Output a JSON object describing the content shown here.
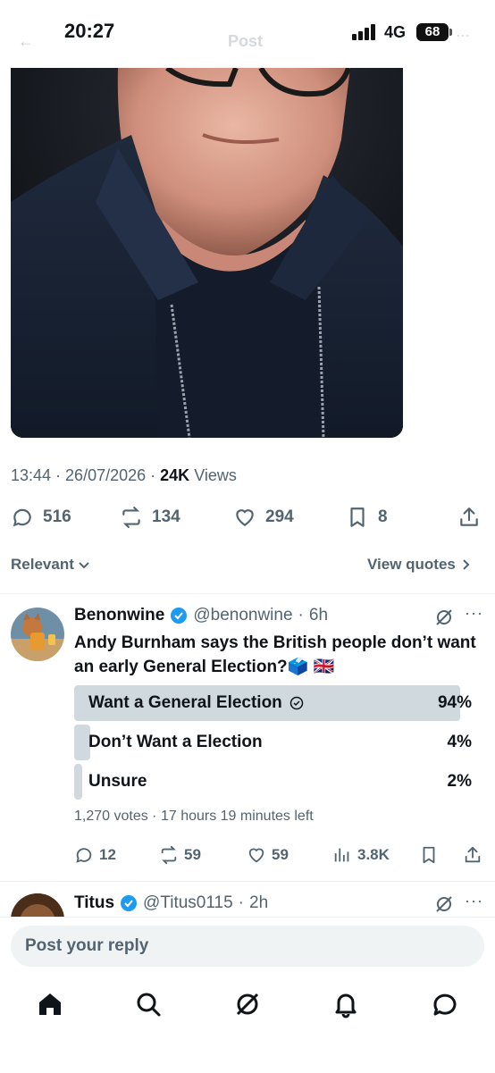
{
  "status_bar": {
    "time": "20:27",
    "network": "4G",
    "battery": "68"
  },
  "header": {
    "title": "Post"
  },
  "tweet_meta": {
    "time": "13:44",
    "date": "26/07/2026",
    "views_count": "24K",
    "views_label": "Views"
  },
  "actions": {
    "replies": "516",
    "reposts": "134",
    "likes": "294",
    "bookmarks": "8"
  },
  "filter": {
    "relevant_label": "Relevant",
    "view_quotes_label": "View quotes"
  },
  "reply_tweet": {
    "name": "Benonwine",
    "handle": "@benonwine",
    "time": "6h",
    "text": "Andy Burnham says the British people don’t want an early General Election?🗳️ 🇬🇧",
    "poll": {
      "options": [
        {
          "label": "Want a General Election",
          "percent": "94%",
          "value": 94
        },
        {
          "label": "Don’t Want a Election",
          "percent": "4%",
          "value": 4
        },
        {
          "label": "Unsure",
          "percent": "2%",
          "value": 2
        }
      ],
      "info": "1,270 votes · 17 hours 19 minutes left"
    },
    "stats": {
      "replies": "12",
      "reposts": "59",
      "likes": "59",
      "views": "3.8K"
    }
  },
  "next_tweet": {
    "name": "Titus",
    "handle": "@Titus0115",
    "time": "2h"
  },
  "reply_input": {
    "placeholder": "Post your reply"
  },
  "colors": {
    "verified": "#1d9bf0",
    "text": "#0f1419",
    "muted": "#536471",
    "poll_bar": "#cfd9de"
  }
}
